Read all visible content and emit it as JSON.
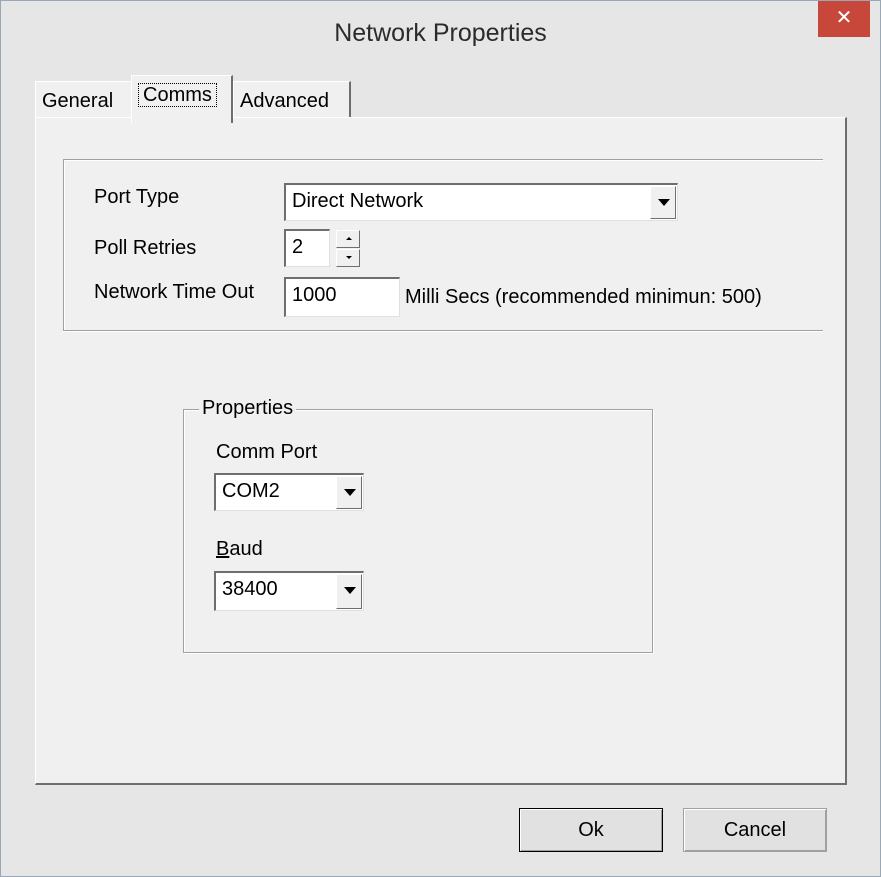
{
  "window": {
    "title": "Network Properties",
    "close_glyph": "✕",
    "accent_close": "#c7473a"
  },
  "tabs": [
    {
      "label": "General",
      "active": false
    },
    {
      "label": "Comms",
      "active": true
    },
    {
      "label": "Advanced",
      "active": false
    }
  ],
  "settings": {
    "port_type_label": "Port Type",
    "port_type_value": "Direct Network",
    "poll_retries_label": "Poll Retries",
    "poll_retries_value": "2",
    "timeout_label": "Network Time Out",
    "timeout_value": "1000",
    "timeout_hint": "Milli Secs (recommended minimun: 500)"
  },
  "properties": {
    "legend": "Properties",
    "comm_port_label": "Comm Port",
    "comm_port_value": "COM2",
    "baud_label_mnemonic": "B",
    "baud_label_rest": "aud",
    "baud_value": "38400"
  },
  "buttons": {
    "ok": "Ok",
    "cancel": "Cancel"
  },
  "icons": {
    "close": "close-icon",
    "dropdown": "chevron-down-icon",
    "spin_up": "arrow-up-icon",
    "spin_down": "arrow-down-icon"
  }
}
